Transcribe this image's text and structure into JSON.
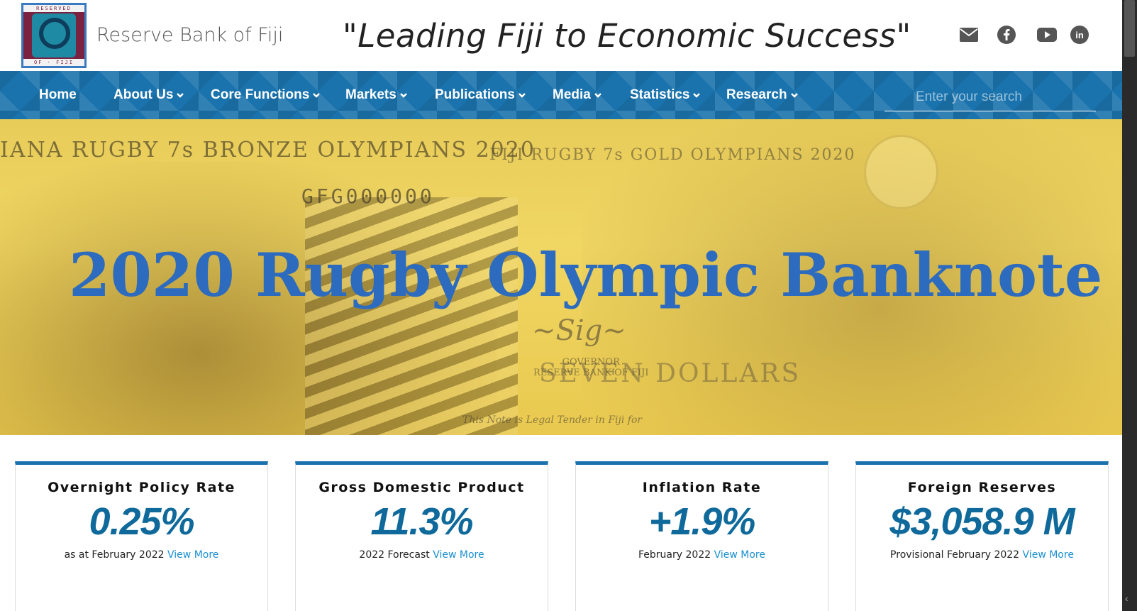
{
  "header": {
    "logo_text_top": "RESERVED",
    "logo_text_bottom": "OF · FIJI",
    "bank_name": "Reserve Bank of Fiji",
    "tagline": "\"Leading Fiji to Economic Success\"",
    "social": [
      "email-icon",
      "facebook-icon",
      "youtube-icon",
      "linkedin-icon"
    ]
  },
  "nav": {
    "items": [
      {
        "label": "Home",
        "has_dropdown": false
      },
      {
        "label": "About Us",
        "has_dropdown": true
      },
      {
        "label": "Core Functions",
        "has_dropdown": true
      },
      {
        "label": "Markets",
        "has_dropdown": true
      },
      {
        "label": "Publications",
        "has_dropdown": true
      },
      {
        "label": "Media",
        "has_dropdown": true
      },
      {
        "label": "Statistics",
        "has_dropdown": true
      },
      {
        "label": "Research",
        "has_dropdown": true
      }
    ],
    "search_placeholder": "Enter your search"
  },
  "hero": {
    "title": "2020 Rugby Olympic Banknote",
    "banner_left": "IANA RUGBY 7s BRONZE OLYMPIANS 2020",
    "banner_right": "FIJI RUGBY 7s GOLD OLYMPIANS 2020",
    "serial": "GFG000000",
    "denomination": "SEVEN DOLLARS",
    "governor_line1": "GOVERNOR",
    "governor_line2": "RESERVE BANK OF FIJI",
    "legal": "This Note is Legal Tender in Fiji for"
  },
  "stats": [
    {
      "title": "Overnight Policy Rate",
      "value": "0.25%",
      "note": "as at February 2022",
      "link": "View More"
    },
    {
      "title": "Gross Domestic Product",
      "value": "11.3%",
      "note": "2022 Forecast",
      "link": "View More"
    },
    {
      "title": "Inflation Rate",
      "value": "+1.9%",
      "note": "February 2022",
      "link": "View More"
    },
    {
      "title": "Foreign Reserves",
      "value": "$3,058.9 M",
      "note": "Provisional February 2022",
      "link": "View More"
    }
  ],
  "colors": {
    "nav_blue": "#1a73ad",
    "value_blue": "#0f6a9b",
    "link_blue": "#1a8fd0",
    "hero_title_blue": "#2d6bbf"
  }
}
